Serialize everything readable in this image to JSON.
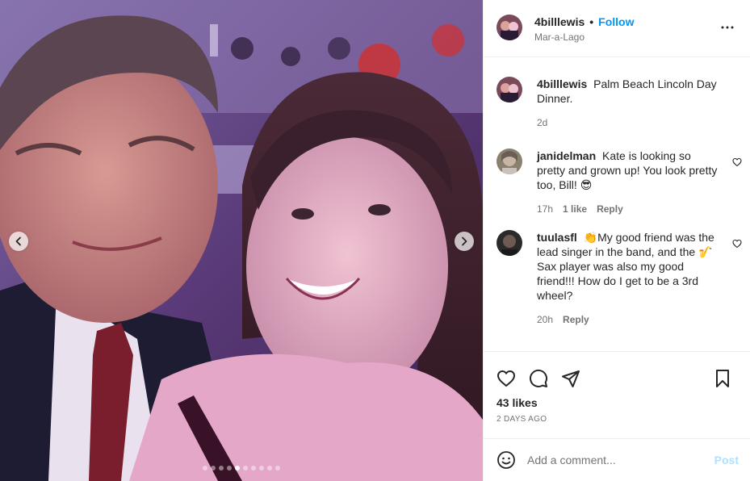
{
  "header": {
    "username": "4billlewis",
    "separator": "•",
    "follow_label": "Follow",
    "location": "Mar-a-Lago",
    "more_icon": "more-horizontal-icon"
  },
  "caption": {
    "username": "4billlewis",
    "text": "Palm Beach Lincoln Day Dinner.",
    "time": "2d"
  },
  "comments": [
    {
      "username": "janidelman",
      "text": "Kate is looking so pretty and grown up! You look pretty too, Bill! 😎",
      "time": "17h",
      "likes": "1 like",
      "reply_label": "Reply"
    },
    {
      "username": "tuulasfl",
      "text": "👏My good friend was the lead singer in the band, and the 🎷 Sax player was also my good friend!!! How do I get to be a 3rd wheel?",
      "time": "20h",
      "reply_label": "Reply"
    }
  ],
  "actions": {
    "like_icon": "heart-icon",
    "comment_icon": "comment-icon",
    "share_icon": "share-icon",
    "save_icon": "bookmark-icon",
    "likes_count": "43 likes",
    "posted_ago": "2 DAYS AGO"
  },
  "add_comment": {
    "placeholder": "Add a comment...",
    "post_label": "Post"
  },
  "carousel": {
    "total": 10,
    "active_index": 4
  },
  "colors": {
    "accent": "#0095f6",
    "post_disabled": "#b2dffc",
    "muted": "#737373"
  }
}
